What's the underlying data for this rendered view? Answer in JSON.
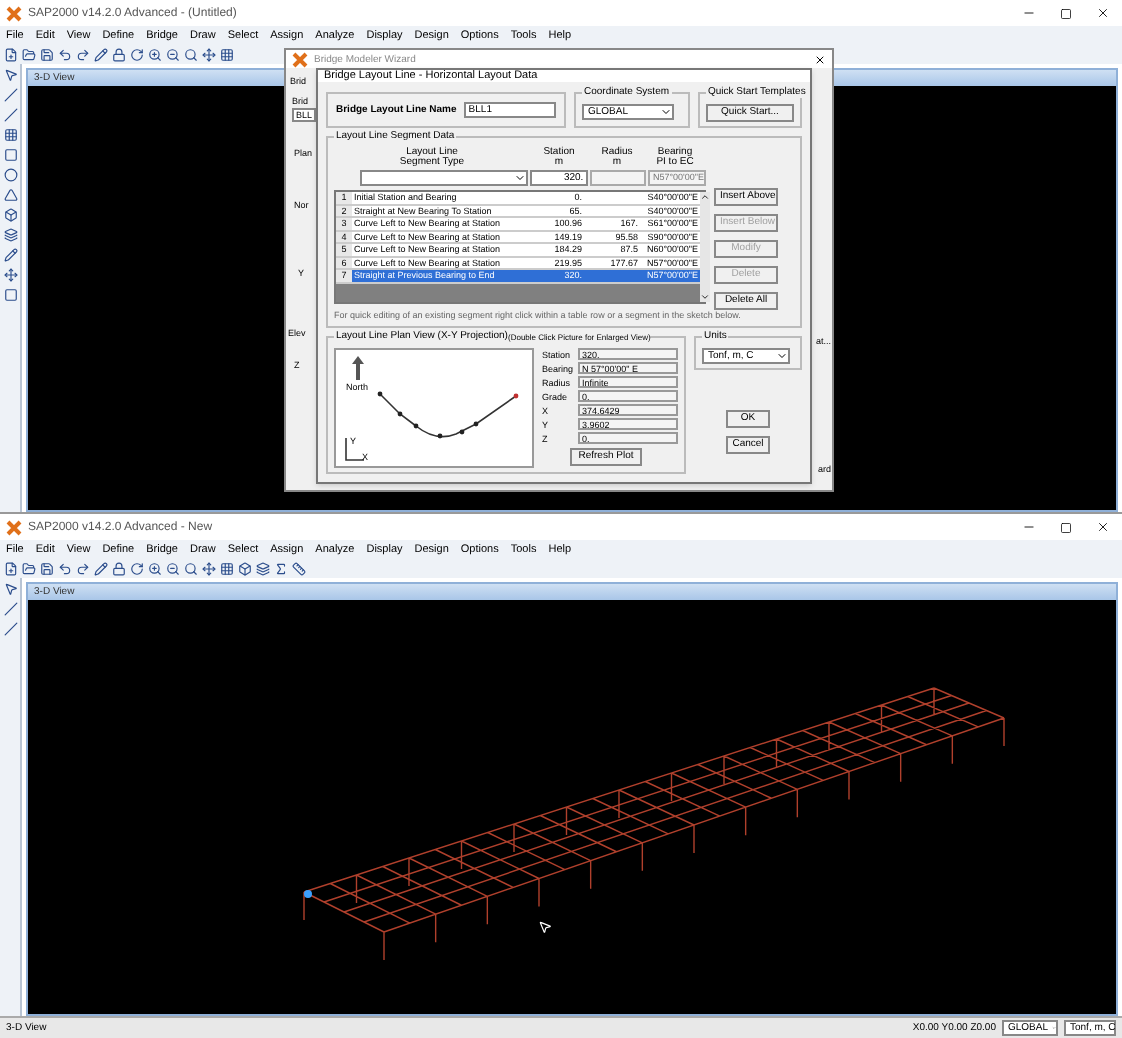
{
  "top_window": {
    "title": "SAP2000 v14.2.0 Advanced - (Untitled)",
    "menu": [
      "File",
      "Edit",
      "View",
      "Define",
      "Bridge",
      "Draw",
      "Select",
      "Assign",
      "Analyze",
      "Display",
      "Design",
      "Options",
      "Tools",
      "Help"
    ],
    "child_window": {
      "title": "3-D View"
    },
    "wizard": {
      "title": "Bridge Modeler Wizard",
      "fragments": [
        "Brid",
        "Brid",
        "BLL",
        "Plan",
        "Nor",
        "Y",
        "Elev",
        "Z",
        "at...",
        "ard"
      ]
    },
    "dialog": {
      "title": "Bridge Layout Line - Horizontal Layout Data",
      "name_label": "Bridge Layout Line Name",
      "name_value": "BLL1",
      "coordinate_system": {
        "label": "Coordinate System",
        "value": "GLOBAL"
      },
      "quick_start": {
        "label": "Quick Start Templates",
        "button": "Quick Start..."
      },
      "segment_data": {
        "label": "Layout Line Segment Data",
        "columns": [
          [
            "Layout Line",
            "Segment Type"
          ],
          [
            "Station",
            "m"
          ],
          [
            "Radius",
            "m"
          ],
          [
            "Bearing",
            "PI to EC"
          ]
        ],
        "input_row": {
          "station": "320.",
          "bearing": "N57°00'00\"E"
        },
        "rows": [
          {
            "number": "1",
            "type": "Initial Station and Bearing",
            "station": "0.",
            "radius": "",
            "bearing": "S40°00'00\"E",
            "selected": false
          },
          {
            "number": "2",
            "type": "Straight at New Bearing To Station",
            "station": "65.",
            "radius": "",
            "bearing": "S40°00'00\"E",
            "selected": false
          },
          {
            "number": "3",
            "type": "Curve Left to New Bearing at Station",
            "station": "100.96",
            "radius": "167.",
            "bearing": "S61°00'00\"E",
            "selected": false
          },
          {
            "number": "4",
            "type": "Curve Left to New Bearing at Station",
            "station": "149.19",
            "radius": "95.58",
            "bearing": "S90°00'00\"E",
            "selected": false
          },
          {
            "number": "5",
            "type": "Curve Left to New Bearing at Station",
            "station": "184.29",
            "radius": "87.5",
            "bearing": "N60°00'00\"E",
            "selected": false
          },
          {
            "number": "6",
            "type": "Curve Left to New Bearing at Station",
            "station": "219.95",
            "radius": "177.67",
            "bearing": "N57°00'00\"E",
            "selected": false
          },
          {
            "number": "7",
            "type": "Straight at Previous Bearing to End",
            "station": "320.",
            "radius": "",
            "bearing": "N57°00'00\"E",
            "selected": true
          }
        ],
        "buttons": [
          {
            "label": "Insert Above",
            "disabled": false
          },
          {
            "label": "Insert Below",
            "disabled": true
          },
          {
            "label": "Modify",
            "disabled": true
          },
          {
            "label": "Delete",
            "disabled": true
          },
          {
            "label": "Delete All",
            "disabled": false
          }
        ],
        "hint": "For quick editing of an existing segment right click within a table row or a segment in the sketch below."
      },
      "plan_view": {
        "label": "Layout Line Plan View (X-Y Projection)",
        "note": "(Double Click Picture for Enlarged View)",
        "north": "North",
        "axis_y": "Y",
        "axis_x": "X",
        "fields": [
          {
            "label": "Station",
            "value": "320."
          },
          {
            "label": "Bearing",
            "value": "N 57°00'00\" E"
          },
          {
            "label": "Radius",
            "value": "Infinite"
          },
          {
            "label": "Grade",
            "value": "0."
          },
          {
            "label": "X",
            "value": "374.6429"
          },
          {
            "label": "Y",
            "value": "3.9602"
          },
          {
            "label": "Z",
            "value": "0."
          }
        ],
        "refresh": "Refresh Plot"
      },
      "units": {
        "label": "Units",
        "value": "Tonf, m, C"
      },
      "buttons": [
        "OK",
        "Cancel"
      ]
    }
  },
  "bottom_window": {
    "title": "SAP2000 v14.2.0 Advanced - New",
    "menu": [
      "File",
      "Edit",
      "View",
      "Define",
      "Bridge",
      "Draw",
      "Select",
      "Assign",
      "Analyze",
      "Display",
      "Design",
      "Options",
      "Tools",
      "Help"
    ],
    "child_window": {
      "title": "3-D View"
    },
    "status_bar": {
      "view": "3-D View",
      "coordinates": "X0.00 Y0.00 Z0.00",
      "coordinate_system": "GLOBAL",
      "units": "Tonf, m, C"
    }
  }
}
